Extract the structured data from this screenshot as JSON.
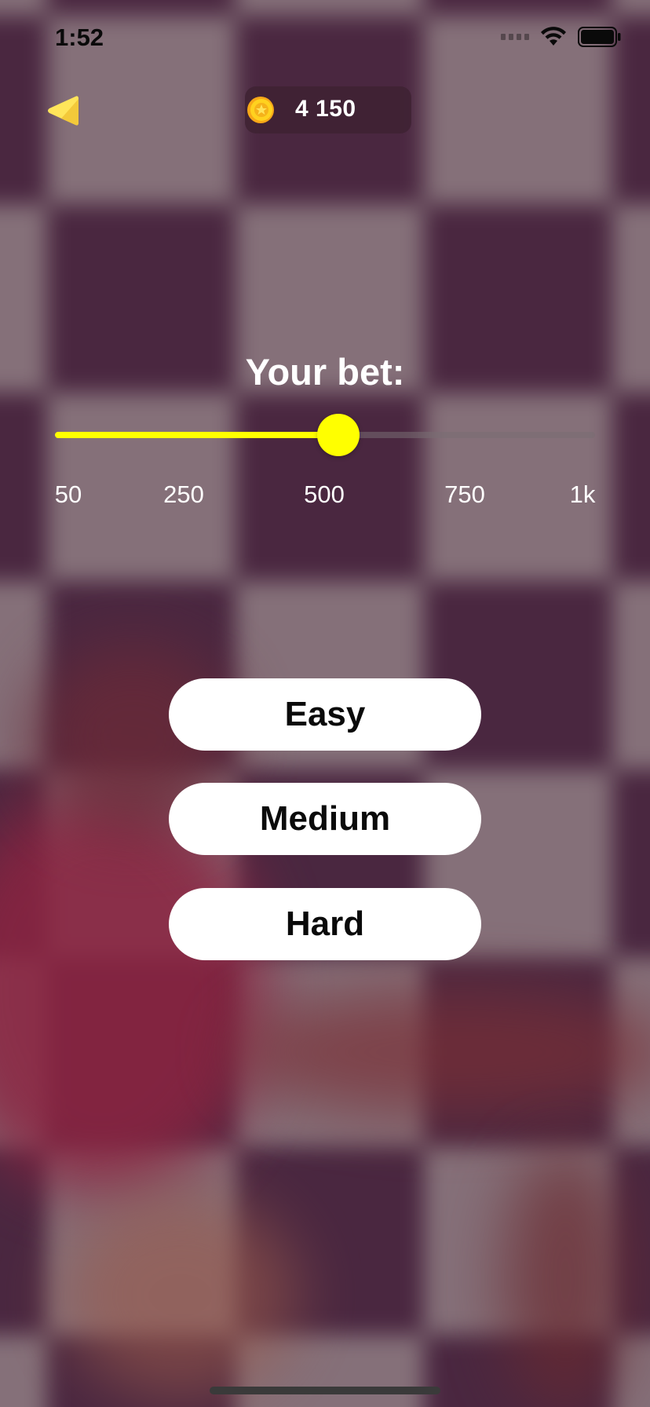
{
  "status_bar": {
    "time": "1:52",
    "icons": [
      "cellular-signal-icon",
      "wifi-icon",
      "battery-icon"
    ]
  },
  "header": {
    "back_icon": "back-triangle-icon",
    "coin_icon": "coin-icon",
    "coin_balance": "4 150"
  },
  "bet": {
    "title": "Your bet:",
    "slider_value_fraction": 0.525,
    "tick_labels": [
      "50",
      "250",
      "500",
      "750",
      "1k"
    ]
  },
  "difficulty": {
    "easy_label": "Easy",
    "medium_label": "Medium",
    "hard_label": "Hard"
  },
  "colors": {
    "accent_yellow": "#ffff00",
    "button_background": "#ffffff",
    "button_text": "#0a0a0a",
    "coin_pill_background": "#3e2232"
  }
}
